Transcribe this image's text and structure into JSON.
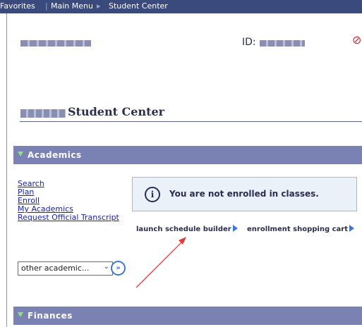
{
  "topnav": {
    "items": [
      "Favorites",
      "Main Menu",
      "Student Center"
    ],
    "sep": "|",
    "sep2": "▸"
  },
  "header": {
    "id_label": "ID:",
    "no_icon": "⊘"
  },
  "center": {
    "title_suffix": "Student Center"
  },
  "academics": {
    "label": "Academics",
    "links": [
      "Search",
      "Plan",
      "Enroll",
      "My Academics",
      "Request Official Transcript"
    ],
    "message": "You are not enrolled in classes.",
    "info_glyph": "i",
    "actions": [
      "launch schedule builder",
      "enrollment shopping cart"
    ],
    "select_value": "other academic...",
    "go_glyph": "»"
  },
  "finances": {
    "label": "Finances"
  },
  "colors": {
    "nav": "#3a4a7c",
    "bar": "#7a82b3",
    "link": "#1a24a0",
    "arrow_annotation": "#e23b3b"
  },
  "icons": {
    "select_chevron": "chevron-down-icon",
    "go": "double-chevron-right-icon"
  }
}
